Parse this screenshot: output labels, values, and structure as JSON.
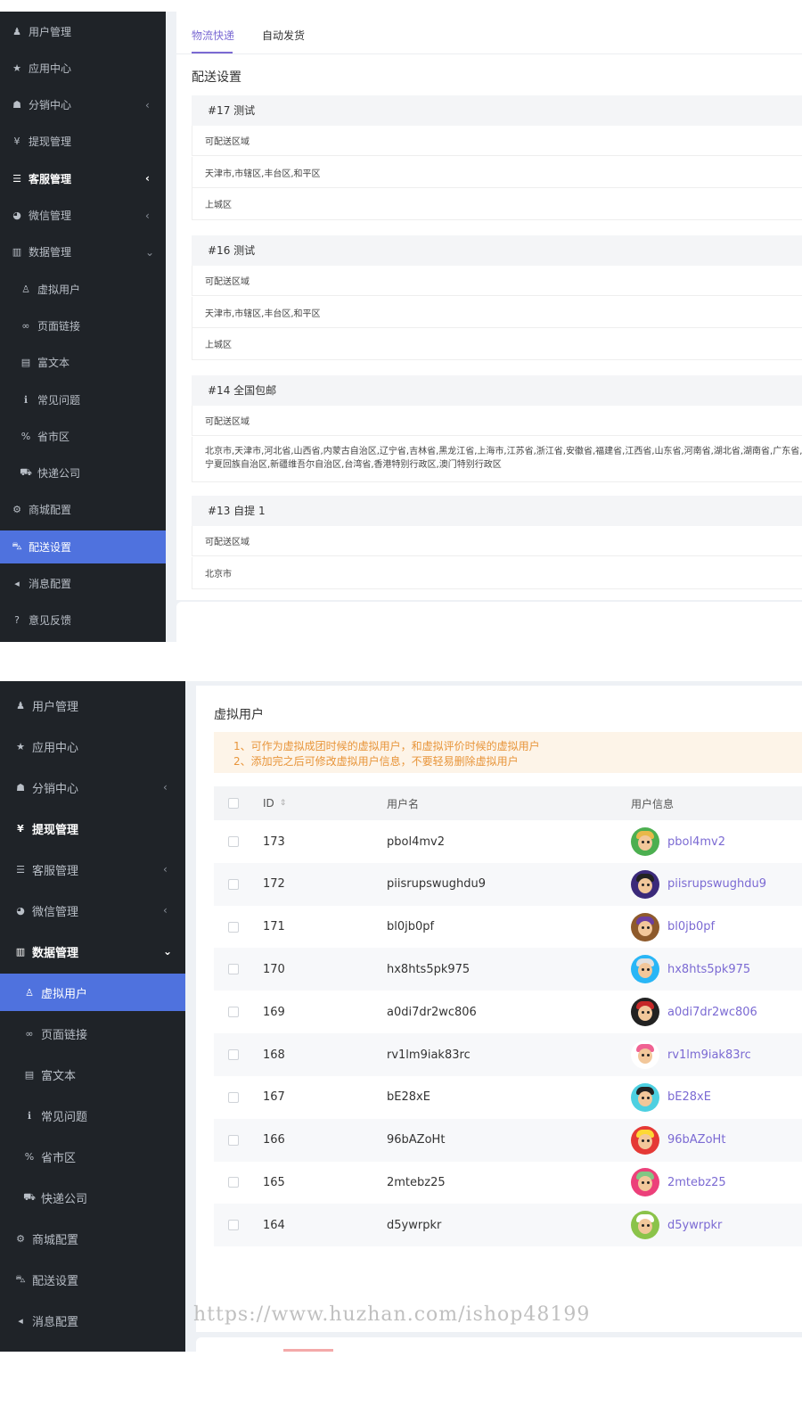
{
  "panel1": {
    "sidebar": [
      {
        "icon": "user-icon",
        "glyph": "♟",
        "label": "用户管理",
        "arrow": ""
      },
      {
        "icon": "star-icon",
        "glyph": "★",
        "label": "应用中心",
        "arrow": ""
      },
      {
        "icon": "users-icon",
        "glyph": "☗",
        "label": "分销中心",
        "arrow": "‹"
      },
      {
        "icon": "yen-icon",
        "glyph": "¥",
        "label": "提现管理",
        "arrow": ""
      },
      {
        "icon": "list-icon",
        "glyph": "☰",
        "label": "客服管理",
        "arrow": "‹"
      },
      {
        "icon": "wechat-icon",
        "glyph": "◕",
        "label": "微信管理",
        "arrow": "‹"
      },
      {
        "icon": "bar-chart-icon",
        "glyph": "▥",
        "label": "数据管理",
        "arrow": "⌄"
      },
      {
        "icon": "user-outline-icon",
        "glyph": "♙",
        "label": "虚拟用户",
        "arrow": ""
      },
      {
        "icon": "link-icon",
        "glyph": "∞",
        "label": "页面链接",
        "arrow": ""
      },
      {
        "icon": "rich-text-icon",
        "glyph": "▤",
        "label": "富文本",
        "arrow": ""
      },
      {
        "icon": "info-icon",
        "glyph": "ℹ",
        "label": "常见问题",
        "arrow": ""
      },
      {
        "icon": "percent-icon",
        "glyph": "%",
        "label": "省市区",
        "arrow": ""
      },
      {
        "icon": "truck-icon",
        "glyph": "⛟",
        "label": "快递公司",
        "arrow": ""
      },
      {
        "icon": "cogs-icon",
        "glyph": "⚙",
        "label": "商城配置",
        "arrow": ""
      },
      {
        "icon": "car-icon",
        "glyph": "⛍",
        "label": "配送设置",
        "arrow": ""
      },
      {
        "icon": "bullhorn-icon",
        "glyph": "◂",
        "label": "消息配置",
        "arrow": ""
      },
      {
        "icon": "question-icon",
        "glyph": "?",
        "label": "意见反馈",
        "arrow": ""
      }
    ],
    "tabs": [
      "物流快递",
      "自动发货"
    ],
    "section_title": "配送设置",
    "zones": [
      {
        "header": "#17  测试",
        "rows": [
          "可配送区域",
          "天津市,市辖区,丰台区,和平区",
          "上城区"
        ]
      },
      {
        "header": "#16  测试",
        "rows": [
          "可配送区域",
          "天津市,市辖区,丰台区,和平区",
          "上城区"
        ]
      },
      {
        "header": "#14  全国包邮",
        "rows": [
          "可配送区域",
          "北京市,天津市,河北省,山西省,内蒙古自治区,辽宁省,吉林省,黑龙江省,上海市,江苏省,浙江省,安徽省,福建省,江西省,山东省,河南省,湖北省,湖南省,广东省,广西",
          "宁夏回族自治区,新疆维吾尔自治区,台湾省,香港特别行政区,澳门特别行政区"
        ]
      },
      {
        "header": "#13  自提 1",
        "rows": [
          "可配送区域",
          "北京市"
        ]
      }
    ]
  },
  "panel2": {
    "sidebar": [
      {
        "icon": "user-icon",
        "glyph": "♟",
        "label": "用户管理",
        "arrow": ""
      },
      {
        "icon": "star-icon",
        "glyph": "★",
        "label": "应用中心",
        "arrow": ""
      },
      {
        "icon": "users-icon",
        "glyph": "☗",
        "label": "分销中心",
        "arrow": "‹"
      },
      {
        "icon": "yen-icon",
        "glyph": "¥",
        "label": "提现管理",
        "arrow": ""
      },
      {
        "icon": "list-icon",
        "glyph": "☰",
        "label": "客服管理",
        "arrow": "‹"
      },
      {
        "icon": "wechat-icon",
        "glyph": "◕",
        "label": "微信管理",
        "arrow": "‹"
      },
      {
        "icon": "bar-chart-icon",
        "glyph": "▥",
        "label": "数据管理",
        "arrow": "⌄"
      },
      {
        "icon": "user-outline-icon",
        "glyph": "♙",
        "label": "虚拟用户",
        "arrow": ""
      },
      {
        "icon": "link-icon",
        "glyph": "∞",
        "label": "页面链接",
        "arrow": ""
      },
      {
        "icon": "rich-text-icon",
        "glyph": "▤",
        "label": "富文本",
        "arrow": ""
      },
      {
        "icon": "info-icon",
        "glyph": "ℹ",
        "label": "常见问题",
        "arrow": ""
      },
      {
        "icon": "percent-icon",
        "glyph": "%",
        "label": "省市区",
        "arrow": ""
      },
      {
        "icon": "truck-icon",
        "glyph": "⛟",
        "label": "快递公司",
        "arrow": ""
      },
      {
        "icon": "cogs-icon",
        "glyph": "⚙",
        "label": "商城配置",
        "arrow": ""
      },
      {
        "icon": "car-icon",
        "glyph": "⛍",
        "label": "配送设置",
        "arrow": ""
      },
      {
        "icon": "bullhorn-icon",
        "glyph": "◂",
        "label": "消息配置",
        "arrow": ""
      }
    ],
    "page_title": "虚拟用户",
    "notice": [
      "1、可作为虚拟成团时候的虚拟用户，和虚拟评价时候的虚拟用户",
      "2、添加完之后可修改虚拟用户信息，不要轻易删除虚拟用户"
    ],
    "columns": {
      "id": "ID",
      "sort_glyph": "⇕",
      "username": "用户名",
      "userinfo": "用户信息"
    },
    "rows": [
      {
        "id": "173",
        "username": "pbol4mv2",
        "avatar_bg": "#4caf50",
        "hair": "#e8b84a"
      },
      {
        "id": "172",
        "username": "piisrupswughdu9",
        "avatar_bg": "#3b2a7a",
        "hair": "#222222"
      },
      {
        "id": "171",
        "username": "bl0jb0pf",
        "avatar_bg": "#8e5a2b",
        "hair": "#6b3fa0"
      },
      {
        "id": "170",
        "username": "hx8hts5pk975",
        "avatar_bg": "#29b6f6",
        "hair": "#e0e0e0"
      },
      {
        "id": "169",
        "username": "a0di7dr2wc806",
        "avatar_bg": "#222222",
        "hair": "#c62828"
      },
      {
        "id": "168",
        "username": "rv1lm9iak83rc",
        "avatar_bg": "#ffffff",
        "hair": "#f06292"
      },
      {
        "id": "167",
        "username": "bE28xE",
        "avatar_bg": "#4dd0e1",
        "hair": "#222222"
      },
      {
        "id": "166",
        "username": "96bAZoHt",
        "avatar_bg": "#e53935",
        "hair": "#fdd835"
      },
      {
        "id": "165",
        "username": "2mtebz25",
        "avatar_bg": "#ec407a",
        "hair": "#81c784"
      },
      {
        "id": "164",
        "username": "d5ywrpkr",
        "avatar_bg": "#8bc34a",
        "hair": "#ffffff"
      }
    ]
  },
  "watermark": "https://www.huzhan.com/ishop48199"
}
